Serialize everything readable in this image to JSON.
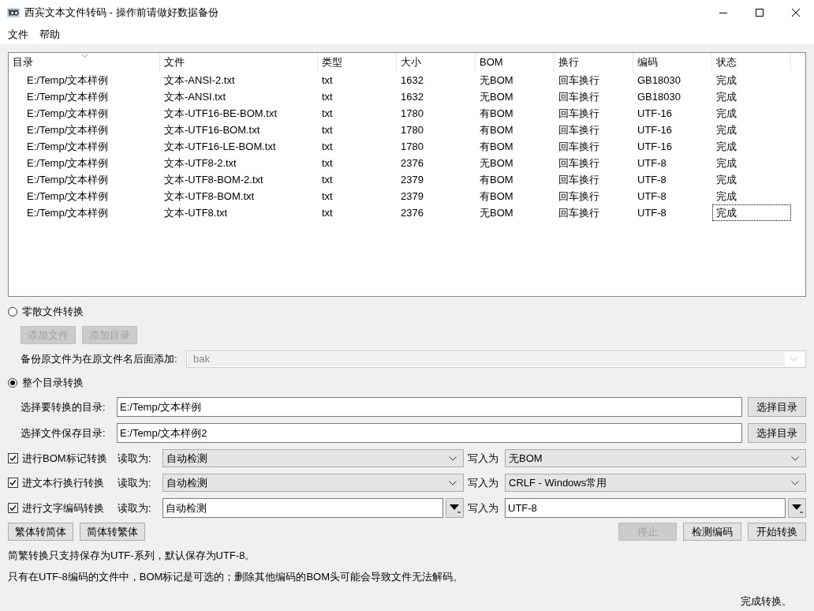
{
  "window": {
    "title": "西宾文本文件转码 - 操作前请做好数据备份"
  },
  "menu": [
    "文件",
    "帮助"
  ],
  "table": {
    "columns": [
      {
        "label": "目录",
        "sorted": true
      },
      {
        "label": "文件",
        "sorted": false
      },
      {
        "label": "类型",
        "sorted": false
      },
      {
        "label": "大小",
        "sorted": false
      },
      {
        "label": "BOM",
        "sorted": false
      },
      {
        "label": "换行",
        "sorted": false
      },
      {
        "label": "编码",
        "sorted": false
      },
      {
        "label": "状态",
        "sorted": false
      }
    ],
    "rows": [
      {
        "cells": [
          "E:/Temp/文本样例",
          "文本-ANSI-2.txt",
          "txt",
          "1632",
          "无BOM",
          "回车换行",
          "GB18030",
          "完成"
        ],
        "focused": false
      },
      {
        "cells": [
          "E:/Temp/文本样例",
          "文本-ANSI.txt",
          "txt",
          "1632",
          "无BOM",
          "回车换行",
          "GB18030",
          "完成"
        ],
        "focused": false
      },
      {
        "cells": [
          "E:/Temp/文本样例",
          "文本-UTF16-BE-BOM.txt",
          "txt",
          "1780",
          "有BOM",
          "回车换行",
          "UTF-16",
          "完成"
        ],
        "focused": false
      },
      {
        "cells": [
          "E:/Temp/文本样例",
          "文本-UTF16-BOM.txt",
          "txt",
          "1780",
          "有BOM",
          "回车换行",
          "UTF-16",
          "完成"
        ],
        "focused": false
      },
      {
        "cells": [
          "E:/Temp/文本样例",
          "文本-UTF16-LE-BOM.txt",
          "txt",
          "1780",
          "有BOM",
          "回车换行",
          "UTF-16",
          "完成"
        ],
        "focused": false
      },
      {
        "cells": [
          "E:/Temp/文本样例",
          "文本-UTF8-2.txt",
          "txt",
          "2376",
          "无BOM",
          "回车换行",
          "UTF-8",
          "完成"
        ],
        "focused": false
      },
      {
        "cells": [
          "E:/Temp/文本样例",
          "文本-UTF8-BOM-2.txt",
          "txt",
          "2379",
          "有BOM",
          "回车换行",
          "UTF-8",
          "完成"
        ],
        "focused": false
      },
      {
        "cells": [
          "E:/Temp/文本样例",
          "文本-UTF8-BOM.txt",
          "txt",
          "2379",
          "有BOM",
          "回车换行",
          "UTF-8",
          "完成"
        ],
        "focused": false
      },
      {
        "cells": [
          "E:/Temp/文本样例",
          "文本-UTF8.txt",
          "txt",
          "2376",
          "无BOM",
          "回车换行",
          "UTF-8",
          "完成"
        ],
        "focused": true
      }
    ]
  },
  "modes": [
    {
      "label": "零散文件转换",
      "selected": false
    },
    {
      "label": "整个目录转换",
      "selected": true
    }
  ],
  "scatter": {
    "buttons": [
      {
        "label": "添加文件",
        "disabled": true
      },
      {
        "label": "添加目录",
        "disabled": true
      }
    ],
    "backup": {
      "label": "备份原文件为在原文件名后面添加:",
      "value": "bak",
      "disabled": true
    }
  },
  "directories": [
    {
      "label": "选择要转换的目录:",
      "value": "E:/Temp/文本样例",
      "button": "选择目录"
    },
    {
      "label": "选择文件保存目录:",
      "value": "E:/Temp/文本样例2",
      "button": "选择目录"
    }
  ],
  "options": [
    {
      "label": "进行BOM标记转换",
      "checked": true,
      "read_label": "读取为:",
      "read_value": "自动检测",
      "write_label": "写入为",
      "write_value": "无BOM",
      "kind": "dropdown"
    },
    {
      "label": "进文本行换行转换",
      "checked": true,
      "read_label": "读取为:",
      "read_value": "自动检测",
      "write_label": "写入为",
      "write_value": "CRLF - Windows常用",
      "kind": "dropdown"
    },
    {
      "label": "进行文字编码转换",
      "checked": true,
      "read_label": "读取为:",
      "read_value": "自动检测",
      "write_label": "写入为",
      "write_value": "UTF-8",
      "kind": "editable"
    }
  ],
  "left_buttons": [
    {
      "label": "繁体转简体",
      "disabled": false
    },
    {
      "label": "简体转繁体",
      "disabled": false
    }
  ],
  "right_buttons": [
    {
      "label": "停止",
      "disabled": true
    },
    {
      "label": "检测编码",
      "disabled": false
    },
    {
      "label": "开始转换",
      "disabled": false
    }
  ],
  "notes": [
    "简繁转换只支持保存为UTF-系列，默认保存为UTF-8。",
    "只有在UTF-8编码的文件中，BOM标记是可选的；删除其他编码的BOM头可能会导致文件无法解码。"
  ],
  "status_bar": {
    "text": "完成转换。"
  }
}
